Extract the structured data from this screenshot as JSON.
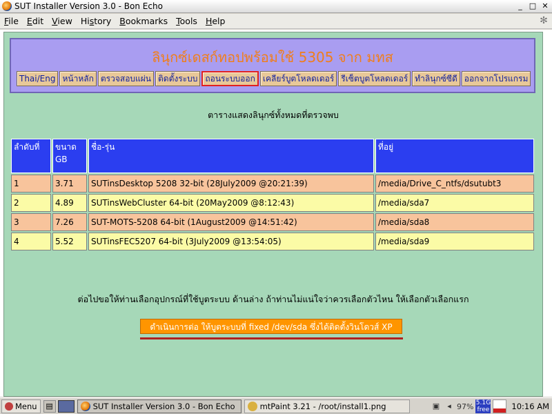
{
  "window": {
    "title": "SUT Installer Version 3.0 - Bon Echo",
    "controls": [
      "_",
      "□",
      "✕"
    ]
  },
  "menubar": [
    {
      "u": "F",
      "rest": "ile"
    },
    {
      "u": "E",
      "rest": "dit"
    },
    {
      "u": "V",
      "rest": "iew"
    },
    {
      "pre": "Hi",
      "u": "s",
      "rest": "tory"
    },
    {
      "u": "B",
      "rest": "ookmarks"
    },
    {
      "u": "T",
      "rest": "ools"
    },
    {
      "u": "H",
      "rest": "elp"
    }
  ],
  "header": {
    "title": "ลินุกซ์เดสก์ทอปพร้อมใช้ 5305 จาก มทส",
    "nav": [
      "Thai/Eng",
      "หน้าหลัก",
      "ตรวจสอบแผ่น",
      "ติดตั้งระบบ",
      "ถอนระบบออก",
      "เคลียร์บูตโหลดเดอร์",
      "รีเซ็ตบูตโหลดเดอร์",
      "ทำลินุกซ์ซีดี",
      "ออกจากโปรแกรม"
    ],
    "active_index": 4
  },
  "main": {
    "subtitle": "ตารางแสดงลินุกซ์ทั้งหมดที่ตรวจพบ",
    "table": {
      "headers": [
        "ลำดับที่",
        "ขนาด GB",
        "ชื่อ-รุ่น",
        "ที่อยู่"
      ],
      "rows": [
        [
          "1",
          "3.71",
          "SUTinsDesktop  5208  32-bit  (28July2009  @20:21:39)",
          "/media/Drive_C_ntfs/dsutubt3"
        ],
        [
          "2",
          "4.89",
          "SUTinsWebCluster  64-bit  (20May2009  @8:12:43)",
          "/media/sda7"
        ],
        [
          "3",
          "7.26",
          "SUT-MOTS-5208  64-bit  (1August2009  @14:51:42)",
          "/media/sda8"
        ],
        [
          "4",
          "5.52",
          "SUTinsFEC5207  64-bit  (3July2009  @13:54:05)",
          "/media/sda9"
        ]
      ]
    },
    "instruction": "ต่อไปขอให้ท่านเลือกอุปกรณ์ที่ใช้บูตระบบ  ด้านล่าง  ถ้าท่านไม่แน่ใจว่าควรเลือกตัวไหน  ให้เลือกตัวเลือกแรก",
    "action_button": "ดำเนินการต่อ  ให้บูตระบบที่  fixed  /dev/sda  ซึ่งได้ติดตั้งวินโดวส์  XP"
  },
  "taskbar": {
    "menu_label": "Menu",
    "tasks": [
      "SUT Installer Version 3.0 - Bon Echo",
      "mtPaint 3.21 - /root/install1.png"
    ],
    "tray": {
      "cpu": "97%",
      "free_size": "5.1G",
      "free_label": "free",
      "clock": "10:16 AM"
    }
  },
  "colors": {
    "panel_bg": "#a6d8b8",
    "header_bg": "#a99df1",
    "header_title": "#f07e1c",
    "table_header": "#2b3ef0",
    "row_odd": "#f8c49c",
    "row_even": "#fbfba6",
    "action_button": "#ff9500"
  }
}
